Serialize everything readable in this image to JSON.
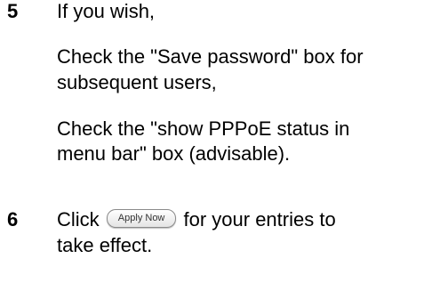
{
  "steps": [
    {
      "number": "5",
      "lines": [
        "If you wish,",
        "Check the \"Save password\" box for",
        "subsequent users,",
        "Check the \"show PPPoE status in",
        "menu bar\" box (advisable)."
      ]
    },
    {
      "number": "6",
      "before_button": "Click",
      "button_label": "Apply Now",
      "after_button": "for your entries to",
      "continuation": "take effect."
    }
  ]
}
